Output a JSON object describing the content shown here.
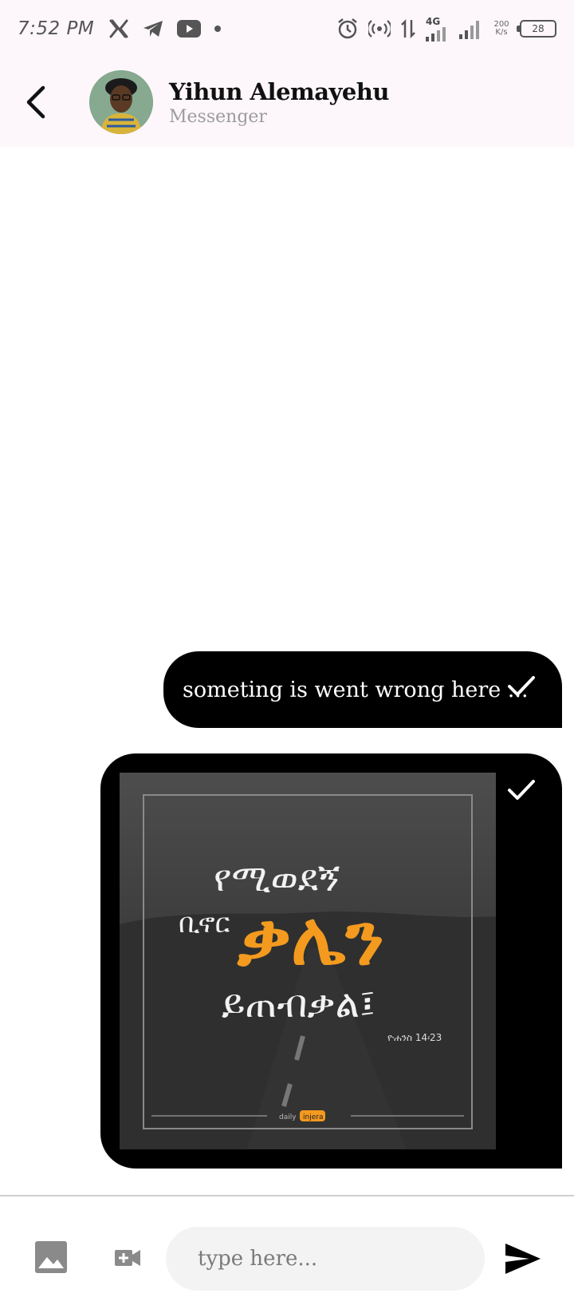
{
  "status_bar": {
    "time": "7:52 PM",
    "network_label": "4G",
    "speed_value": "200",
    "speed_unit": "K/s",
    "battery_level": "28"
  },
  "header": {
    "contact_name": "Yihun Alemayehu",
    "subtitle": "Messenger"
  },
  "messages": [
    {
      "type": "text",
      "text": "someting is went wrong here ...",
      "status_icon": "check-icon"
    },
    {
      "type": "image",
      "status_icon": "check-icon",
      "image_caption_logo": "daily injera"
    }
  ],
  "composer": {
    "placeholder": "type here..."
  },
  "colors": {
    "bubble": "#000000",
    "header_bg": "#fdf7fb",
    "accent_orange": "#f39a1f",
    "input_bg": "#f3f3f3"
  }
}
